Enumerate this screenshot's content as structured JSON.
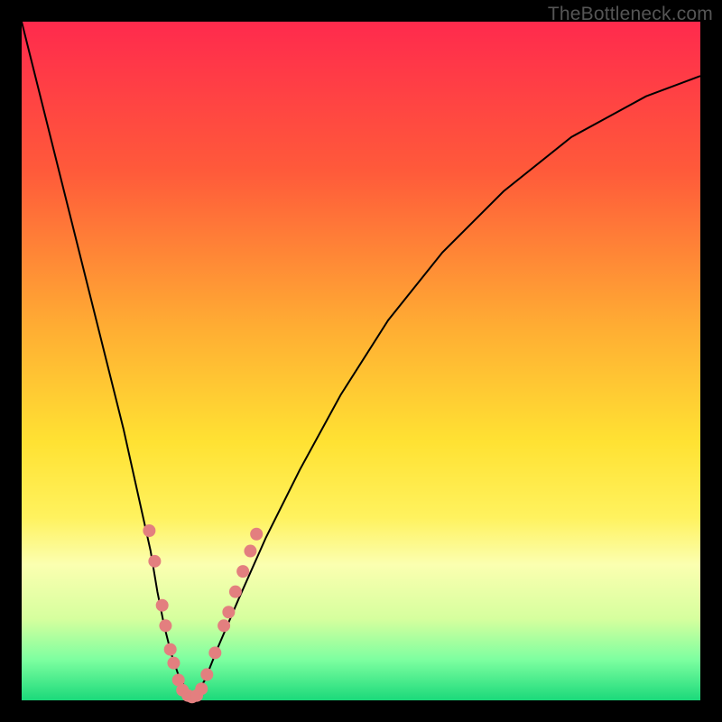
{
  "watermark": "TheBottleneck.com",
  "chart_data": {
    "type": "line",
    "title": "",
    "xlabel": "",
    "ylabel": "",
    "xlim": [
      0,
      100
    ],
    "ylim": [
      0,
      100
    ],
    "grid": false,
    "legend": false,
    "background_gradient": {
      "direction": "top-to-bottom",
      "stops": [
        {
          "pos": 0.0,
          "color": "#ff2a4d"
        },
        {
          "pos": 0.22,
          "color": "#ff5a3a"
        },
        {
          "pos": 0.45,
          "color": "#ffad33"
        },
        {
          "pos": 0.62,
          "color": "#ffe233"
        },
        {
          "pos": 0.73,
          "color": "#fff25e"
        },
        {
          "pos": 0.8,
          "color": "#fbffb0"
        },
        {
          "pos": 0.88,
          "color": "#d6ff9e"
        },
        {
          "pos": 0.94,
          "color": "#7dffa0"
        },
        {
          "pos": 1.0,
          "color": "#1bd97a"
        }
      ]
    },
    "series": [
      {
        "name": "bottleneck-curve",
        "color": "#000000",
        "stroke_width": 2,
        "x": [
          0,
          3,
          6,
          9,
          12,
          15,
          17,
          19,
          20,
          21,
          22,
          23,
          24,
          24.7,
          25.5,
          27,
          29,
          32,
          36,
          41,
          47,
          54,
          62,
          71,
          81,
          92,
          100
        ],
        "values": [
          100,
          88,
          76,
          64,
          52,
          40,
          31,
          22,
          16,
          11,
          7,
          4,
          2,
          0.6,
          0.5,
          3,
          8,
          15,
          24,
          34,
          45,
          56,
          66,
          75,
          83,
          89,
          92
        ]
      }
    ],
    "markers": {
      "name": "highlight-dots",
      "color": "#e37f7f",
      "radius": 7,
      "points": [
        {
          "x": 18.8,
          "y": 25.0
        },
        {
          "x": 19.6,
          "y": 20.5
        },
        {
          "x": 20.7,
          "y": 14.0
        },
        {
          "x": 21.2,
          "y": 11.0
        },
        {
          "x": 21.9,
          "y": 7.5
        },
        {
          "x": 22.4,
          "y": 5.5
        },
        {
          "x": 23.1,
          "y": 3.0
        },
        {
          "x": 23.7,
          "y": 1.5
        },
        {
          "x": 24.5,
          "y": 0.7
        },
        {
          "x": 25.1,
          "y": 0.5
        },
        {
          "x": 25.8,
          "y": 0.7
        },
        {
          "x": 26.5,
          "y": 1.7
        },
        {
          "x": 27.3,
          "y": 3.8
        },
        {
          "x": 28.5,
          "y": 7.0
        },
        {
          "x": 29.8,
          "y": 11.0
        },
        {
          "x": 30.5,
          "y": 13.0
        },
        {
          "x": 31.5,
          "y": 16.0
        },
        {
          "x": 32.6,
          "y": 19.0
        },
        {
          "x": 33.7,
          "y": 22.0
        },
        {
          "x": 34.6,
          "y": 24.5
        }
      ]
    }
  }
}
